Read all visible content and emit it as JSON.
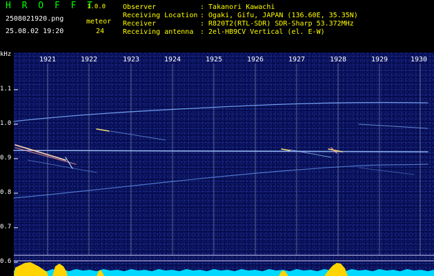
{
  "header": {
    "brand": "H R O F F T",
    "version": "1.0.0",
    "filename": "2508021920.png",
    "datetime": "25.08.02 19:20",
    "meteor_label": "meteor",
    "meteor_count": "24",
    "fields": [
      {
        "label": "Observer",
        "value": ": Takanori Kawachi"
      },
      {
        "label": "Receiving Location",
        "value": ": Ogaki, Gifu, JAPAN (136.60E, 35.35N)"
      },
      {
        "label": "Receiver",
        "value": ": R820T2(RTL-SDR) SDR-Sharp 53.372MHz"
      },
      {
        "label": "Receiving antenna",
        "value": ": 2el-HB9CV Vertical (el. E-W)"
      }
    ]
  },
  "axis": {
    "y_unit": "kHz",
    "y_ticks": [
      "1.1",
      "1.0",
      "0.9",
      "0.8",
      "0.7",
      "0.6"
    ],
    "x_ticks": [
      "1921",
      "1922",
      "1923",
      "1924",
      "1925",
      "1926",
      "1927",
      "1928",
      "1929",
      "1930"
    ]
  },
  "colors": {
    "background": "#000000",
    "header_green": "#00ff00",
    "header_yellow": "#ffff00",
    "plot_bg": "#050a4a",
    "signal": "#6fa8ff",
    "baseline_cyan": "#00e5ff",
    "meteor_yellow": "#ffd400"
  }
}
